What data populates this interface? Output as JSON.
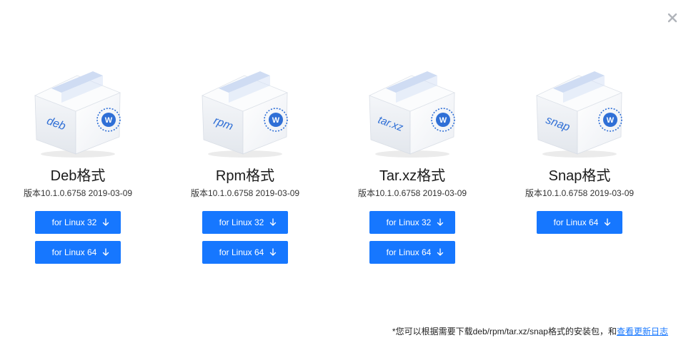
{
  "close": {
    "icon": "close-icon"
  },
  "colors": {
    "accent": "#1677ff",
    "box_label": "#2f6fd6"
  },
  "packages": [
    {
      "box_label": "deb",
      "title": "Deb格式",
      "version": "版本10.1.0.6758 2019-03-09",
      "buttons": [
        {
          "label": "for Linux 32"
        },
        {
          "label": "for Linux 64"
        }
      ]
    },
    {
      "box_label": "rpm",
      "title": "Rpm格式",
      "version": "版本10.1.0.6758 2019-03-09",
      "buttons": [
        {
          "label": "for Linux 32"
        },
        {
          "label": "for Linux 64"
        }
      ]
    },
    {
      "box_label": "tar.xz",
      "title": "Tar.xz格式",
      "version": "版本10.1.0.6758 2019-03-09",
      "buttons": [
        {
          "label": "for Linux 32"
        },
        {
          "label": "for Linux 64"
        }
      ]
    },
    {
      "box_label": "snap",
      "title": "Snap格式",
      "version": "版本10.1.0.6758 2019-03-09",
      "buttons": [
        {
          "label": "for Linux 64"
        }
      ]
    }
  ],
  "footer": {
    "note": "*您可以根据需要下载deb/rpm/tar.xz/snap格式的安装包，和",
    "link": "查看更新日志"
  }
}
